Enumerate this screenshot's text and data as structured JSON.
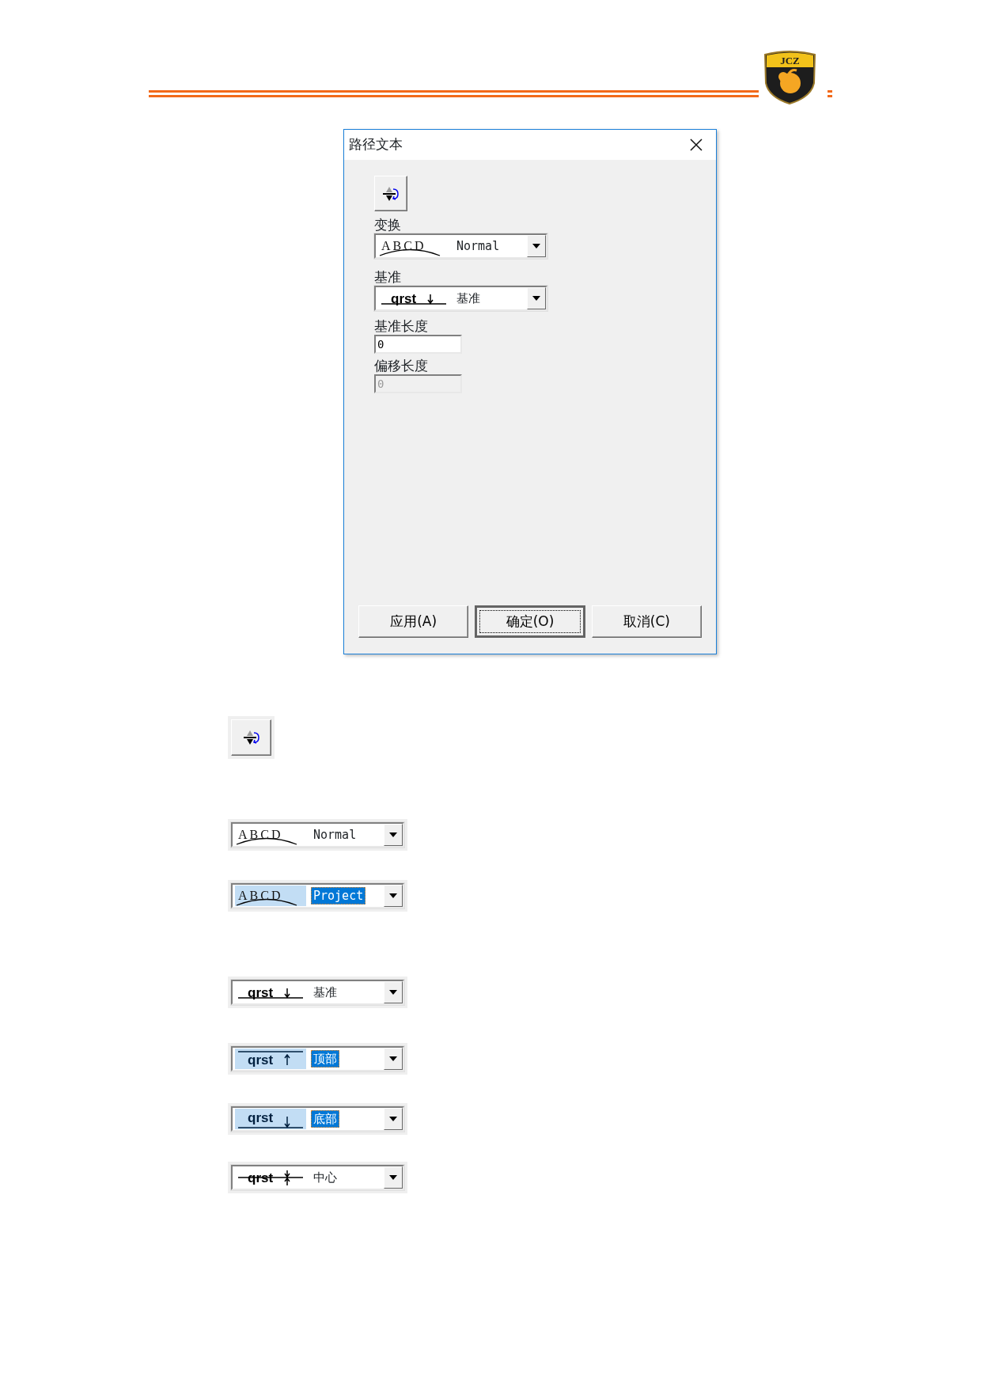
{
  "logo": {
    "text": "JCZ"
  },
  "dialog": {
    "title": "路径文本",
    "transform": {
      "label": "变换",
      "combo": {
        "kind": "arc",
        "sample": "ABCD",
        "value": "Normal",
        "selected": false
      }
    },
    "baseline": {
      "label": "基准",
      "combo": {
        "kind": "baseline",
        "sample": "qrst",
        "value": "基准",
        "selected": false
      }
    },
    "base_length": {
      "label": "基准长度",
      "value": "0",
      "disabled": false
    },
    "offset_length": {
      "label": "偏移长度",
      "value": "0",
      "disabled": true
    },
    "buttons": [
      {
        "label": "应用(A)",
        "default": false
      },
      {
        "label": "确定(O)",
        "default": true
      },
      {
        "label": "取消(C)",
        "default": false
      }
    ]
  },
  "figures": [
    {
      "kind": "icon_button"
    },
    {
      "kind": "combo",
      "combo": {
        "kind": "arc",
        "sample": "ABCD",
        "value": "Normal",
        "selected": false
      }
    },
    {
      "kind": "combo",
      "combo": {
        "kind": "arc",
        "sample": "ABCD",
        "value": "Project",
        "selected": true
      }
    },
    {
      "kind": "combo",
      "combo": {
        "kind": "baseline",
        "sample": "qrst",
        "value": "基准",
        "selected": false
      }
    },
    {
      "kind": "combo",
      "combo": {
        "kind": "top",
        "sample": "qrst",
        "value": "顶部",
        "selected": true
      }
    },
    {
      "kind": "combo",
      "combo": {
        "kind": "bottom",
        "sample": "qrst",
        "value": "底部",
        "selected": true
      }
    },
    {
      "kind": "combo",
      "combo": {
        "kind": "center",
        "sample": "qrst",
        "value": "中心",
        "selected": false
      }
    }
  ]
}
